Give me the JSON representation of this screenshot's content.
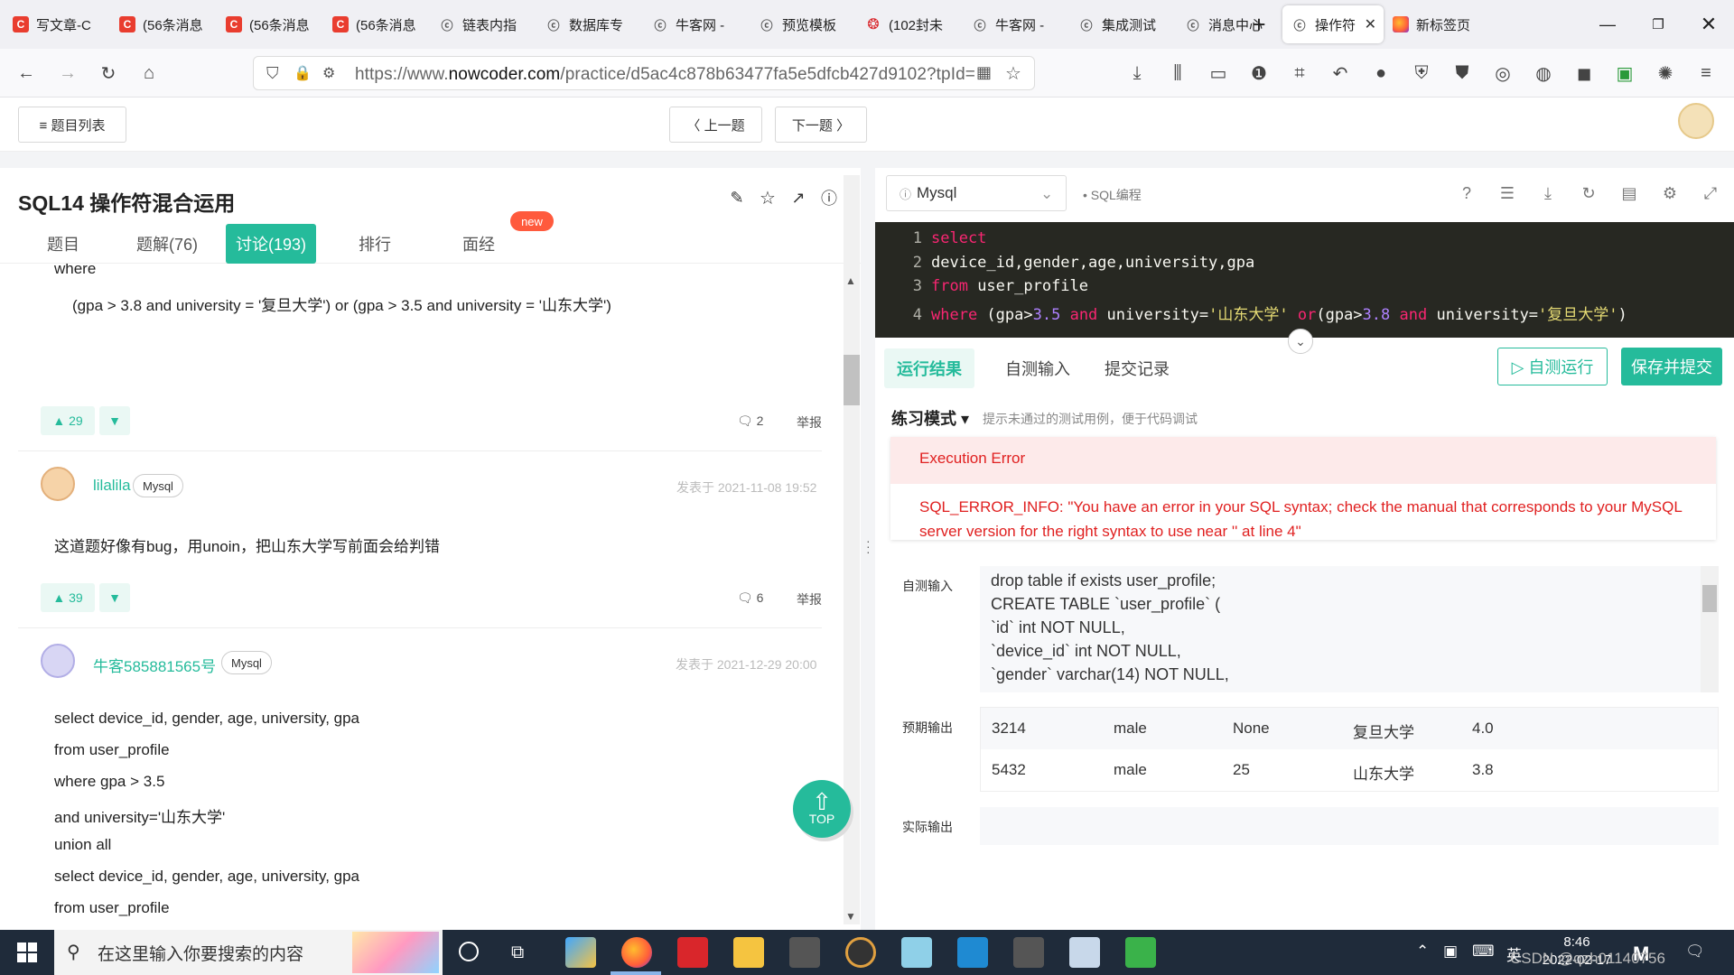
{
  "browser": {
    "tabs": [
      {
        "icon": "csdn",
        "title": "写文章-C"
      },
      {
        "icon": "csdn",
        "title": "(56条消息"
      },
      {
        "icon": "csdn",
        "title": "(56条消息"
      },
      {
        "icon": "csdn",
        "title": "(56条消息"
      },
      {
        "icon": "nk",
        "title": "链表内指"
      },
      {
        "icon": "nk",
        "title": "数据库专"
      },
      {
        "icon": "nk",
        "title": "牛客网 -"
      },
      {
        "icon": "nk",
        "title": "预览模板"
      },
      {
        "icon": "wb",
        "title": "(102封未"
      },
      {
        "icon": "nk",
        "title": "牛客网 -"
      },
      {
        "icon": "nk",
        "title": "集成测试"
      },
      {
        "icon": "nk",
        "title": "消息中心"
      },
      {
        "icon": "nk",
        "title": "操作符"
      },
      {
        "icon": "ff",
        "title": "新标签页"
      }
    ],
    "active_tab_index": 12,
    "url_prefix": "https://www.",
    "url_domain": "nowcoder.com",
    "url_rest": "/practice/d5ac4c878b63477fa5e5dfcb427d9102?tpId="
  },
  "header": {
    "list_label": "≡ 题目列表",
    "prev_label": "〈 上一题",
    "next_label": "下一题 〉"
  },
  "problem": {
    "title": "SQL14  操作符混合运用",
    "tabs": [
      "题目",
      "题解(76)",
      "讨论(193)",
      "排行",
      "面经"
    ],
    "active_tab": 2,
    "new_badge": "new"
  },
  "discussion": {
    "partial_where": "where",
    "partial_condition": "(gpa > 3.8 and university = '复旦大学') or (gpa > 3.5 and university = '山东大学')",
    "post1_votes": "29",
    "post1_comments": "2",
    "report": "举报",
    "post2": {
      "user": "lilalila",
      "tag": "Mysql",
      "date": "发表于 2021-11-08 19:52",
      "text": "这道题好像有bug，用unoin，把山东大学写前面会给判错",
      "votes": "39",
      "comments": "6"
    },
    "post3": {
      "user": "牛客585881565号",
      "tag": "Mysql",
      "date": "发表于 2021-12-29 20:00",
      "lines": [
        "select device_id, gender, age, university, gpa",
        "from user_profile",
        "where gpa > 3.5",
        "and university='山东大学'",
        "union all",
        "select device_id, gender, age, university, gpa",
        "from user_profile"
      ]
    },
    "top_label": "TOP"
  },
  "editor": {
    "language": "Mysql",
    "category": "• SQL编程",
    "line_numbers": [
      "1",
      "2",
      "3",
      "4"
    ],
    "lines": [
      {
        "parts": [
          [
            "kw",
            "select"
          ]
        ]
      },
      {
        "parts": [
          [
            "",
            "device_id,gender,age,university,gpa"
          ]
        ]
      },
      {
        "parts": [
          [
            "kw",
            "from"
          ],
          [
            "",
            " user_profile"
          ]
        ]
      },
      {
        "parts": [
          [
            "kw",
            "where"
          ],
          [
            "",
            " (gpa>"
          ],
          [
            "num",
            "3.5"
          ],
          [
            "",
            " "
          ],
          [
            "kw",
            "and"
          ],
          [
            "",
            " university="
          ],
          [
            "str",
            "'山东大学'"
          ],
          [
            "",
            " "
          ],
          [
            "kw",
            "or"
          ],
          [
            "",
            "(gpa>"
          ],
          [
            "num",
            "3.8"
          ],
          [
            "",
            " "
          ],
          [
            "kw",
            "and"
          ],
          [
            "",
            " university="
          ],
          [
            "str",
            "'复旦大学'"
          ],
          [
            "",
            ")"
          ]
        ]
      }
    ]
  },
  "results": {
    "tabs": [
      "运行结果",
      "自测输入",
      "提交记录"
    ],
    "active_tab": 0,
    "run_label": "▷ 自测运行",
    "save_label": "保存并提交",
    "mode_label": "练习模式 ▾",
    "mode_hint": "提示未通过的测试用例，便于代码调试",
    "error_title": "Execution Error",
    "error_message": "SQL_ERROR_INFO: \"You have an error in your SQL syntax; check the manual that corresponds to your MySQL server version for the right syntax to use near '' at line 4\"",
    "input_label": "自测输入",
    "input_lines": [
      "drop table if exists user_profile;",
      "CREATE TABLE `user_profile` (",
      "`id` int NOT NULL,",
      "`device_id` int NOT NULL,",
      "`gender` varchar(14) NOT NULL,"
    ],
    "expected_label": "预期输出",
    "expected_rows": [
      [
        "3214",
        "male",
        "None",
        "复旦大学",
        "4.0"
      ],
      [
        "5432",
        "male",
        "25",
        "山东大学",
        "3.8"
      ]
    ],
    "actual_label": "实际输出"
  },
  "taskbar": {
    "search_placeholder": "在这里输入你要搜索的内容",
    "ime": "英",
    "time": "8:46",
    "date": "2022-02-17",
    "watermark": "CSDN @qzh01140756"
  },
  "colors": {
    "accent": "#25bb9b",
    "error": "#e02020",
    "editor_bg": "#272822"
  }
}
